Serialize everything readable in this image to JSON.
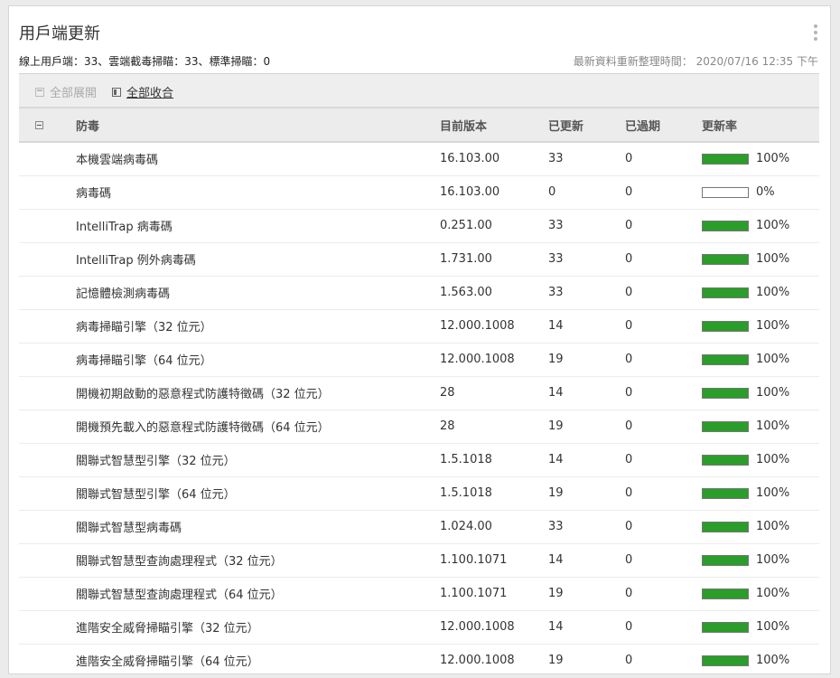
{
  "panel": {
    "title": "用戶端更新",
    "summary": "線上用戶端：33、雲端截毒掃瞄：33、標準掃瞄：0",
    "refresh": "最新資料重新整理時間： 2020/07/16 12:35 下午"
  },
  "toolbar": {
    "expand_all": "全部展開",
    "collapse_all": "全部收合"
  },
  "table": {
    "headers": {
      "name": "防毒",
      "version": "目前版本",
      "updated": "已更新",
      "outdated": "已過期",
      "rate": "更新率"
    },
    "rows": [
      {
        "name": "本機雲端病毒碼",
        "version": "16.103.00",
        "updated": "33",
        "outdated": "0",
        "rate": 1.0,
        "rate_label": "100%"
      },
      {
        "name": "病毒碼",
        "version": "16.103.00",
        "updated": "0",
        "outdated": "0",
        "rate": 0.0,
        "rate_label": "0%"
      },
      {
        "name": "IntelliTrap 病毒碼",
        "version": "0.251.00",
        "updated": "33",
        "outdated": "0",
        "rate": 1.0,
        "rate_label": "100%"
      },
      {
        "name": "IntelliTrap 例外病毒碼",
        "version": "1.731.00",
        "updated": "33",
        "outdated": "0",
        "rate": 1.0,
        "rate_label": "100%"
      },
      {
        "name": "記憶體檢測病毒碼",
        "version": "1.563.00",
        "updated": "33",
        "outdated": "0",
        "rate": 1.0,
        "rate_label": "100%"
      },
      {
        "name": "病毒掃瞄引擎（32 位元）",
        "version": "12.000.1008",
        "updated": "14",
        "outdated": "0",
        "rate": 1.0,
        "rate_label": "100%"
      },
      {
        "name": "病毒掃瞄引擎（64 位元）",
        "version": "12.000.1008",
        "updated": "19",
        "outdated": "0",
        "rate": 1.0,
        "rate_label": "100%"
      },
      {
        "name": "開機初期啟動的惡意程式防護特徵碼（32 位元）",
        "version": "28",
        "updated": "14",
        "outdated": "0",
        "rate": 1.0,
        "rate_label": "100%"
      },
      {
        "name": "開機預先載入的惡意程式防護特徵碼（64 位元）",
        "version": "28",
        "updated": "19",
        "outdated": "0",
        "rate": 1.0,
        "rate_label": "100%"
      },
      {
        "name": "關聯式智慧型引擎（32 位元）",
        "version": "1.5.1018",
        "updated": "14",
        "outdated": "0",
        "rate": 1.0,
        "rate_label": "100%"
      },
      {
        "name": "關聯式智慧型引擎（64 位元）",
        "version": "1.5.1018",
        "updated": "19",
        "outdated": "0",
        "rate": 1.0,
        "rate_label": "100%"
      },
      {
        "name": "關聯式智慧型病毒碼",
        "version": "1.024.00",
        "updated": "33",
        "outdated": "0",
        "rate": 1.0,
        "rate_label": "100%"
      },
      {
        "name": "關聯式智慧型查詢處理程式（32 位元）",
        "version": "1.100.1071",
        "updated": "14",
        "outdated": "0",
        "rate": 1.0,
        "rate_label": "100%"
      },
      {
        "name": "關聯式智慧型查詢處理程式（64 位元）",
        "version": "1.100.1071",
        "updated": "19",
        "outdated": "0",
        "rate": 1.0,
        "rate_label": "100%"
      },
      {
        "name": "進階安全威脅掃瞄引擎（32 位元）",
        "version": "12.000.1008",
        "updated": "14",
        "outdated": "0",
        "rate": 1.0,
        "rate_label": "100%"
      },
      {
        "name": "進階安全威脅掃瞄引擎（64 位元）",
        "version": "12.000.1008",
        "updated": "19",
        "outdated": "0",
        "rate": 1.0,
        "rate_label": "100%"
      }
    ]
  },
  "colors": {
    "bar_fill": "#2a9d2a"
  }
}
